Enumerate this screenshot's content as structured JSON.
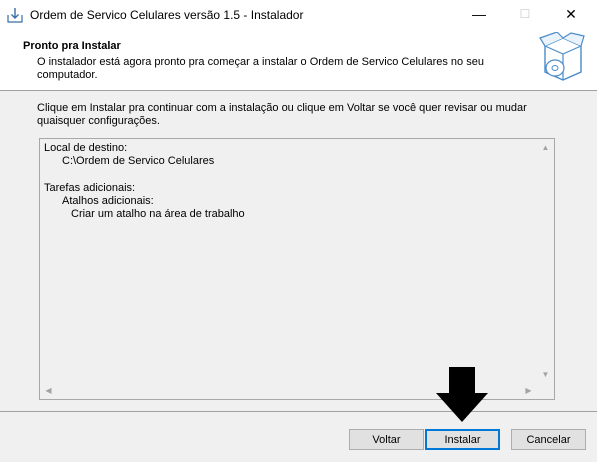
{
  "window": {
    "title": "Ordem de Servico Celulares versão 1.5 - Instalador",
    "controls": {
      "minimize": "—",
      "maximize": "☐",
      "close": "✕"
    }
  },
  "header": {
    "title": "Pronto pra Instalar",
    "subtitle": "O instalador está agora pronto pra começar a instalar o Ordem de Servico Celulares no seu computador."
  },
  "body": {
    "instructions": "Clique em Instalar pra continuar com a instalação ou clique em Voltar se você quer revisar ou mudar quaisquer configurações.",
    "summary": {
      "destination_label": "Local de destino:",
      "destination_path": "C:\\Ordem de Servico Celulares",
      "tasks_label": "Tarefas adicionais:",
      "shortcuts_label": "Atalhos adicionais:",
      "shortcut_item": "Criar um atalho na área de trabalho"
    }
  },
  "buttons": {
    "back": "Voltar",
    "install": "Instalar",
    "cancel": "Cancelar"
  },
  "colors": {
    "accent": "#0078d7",
    "panel": "#f0f0f0",
    "annotation": "#000000"
  }
}
